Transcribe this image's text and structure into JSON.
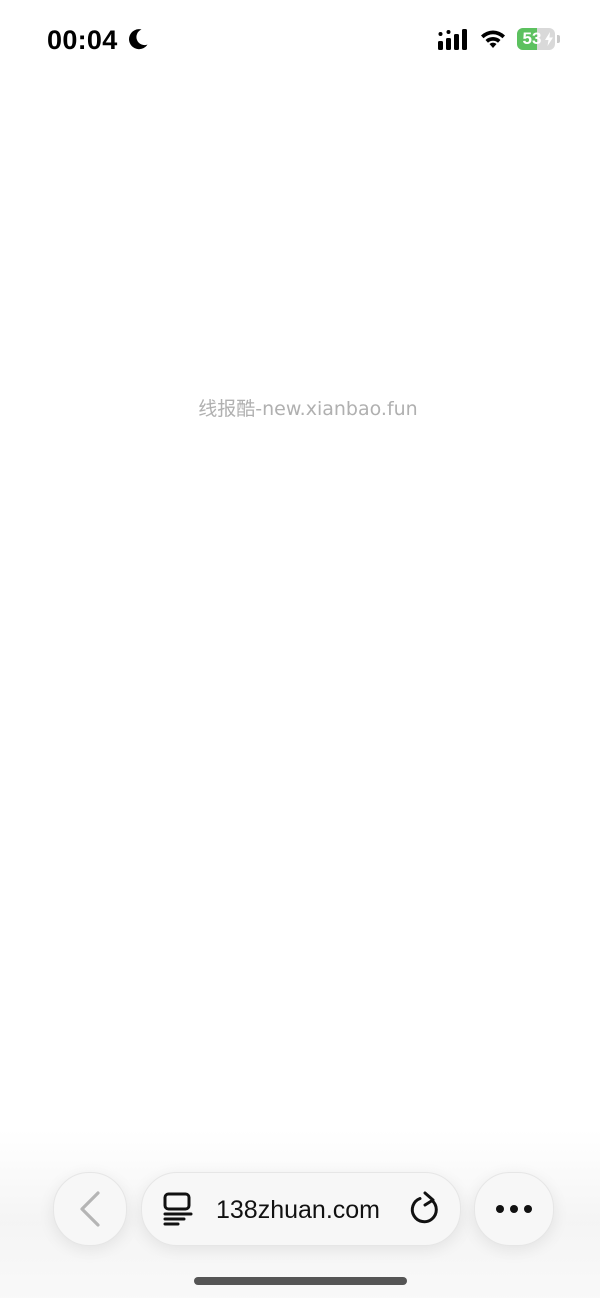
{
  "status_bar": {
    "time": "00:04",
    "focus_icon": "moon-icon",
    "signal_icon": "cellular-signal-icon",
    "wifi_icon": "wifi-icon",
    "battery_level": "53",
    "battery_fraction": 0.53,
    "battery_charging": true,
    "battery_color": "#5cc15f"
  },
  "page": {
    "watermark_text": "线报酷-new.xianbao.fun",
    "background": "#ffffff"
  },
  "toolbar": {
    "back_icon": "chevron-left-icon",
    "reader_icon": "page-menu-icon",
    "url": "138zhuan.com",
    "reload_icon": "reload-icon",
    "more_icon": "ellipsis-icon"
  }
}
